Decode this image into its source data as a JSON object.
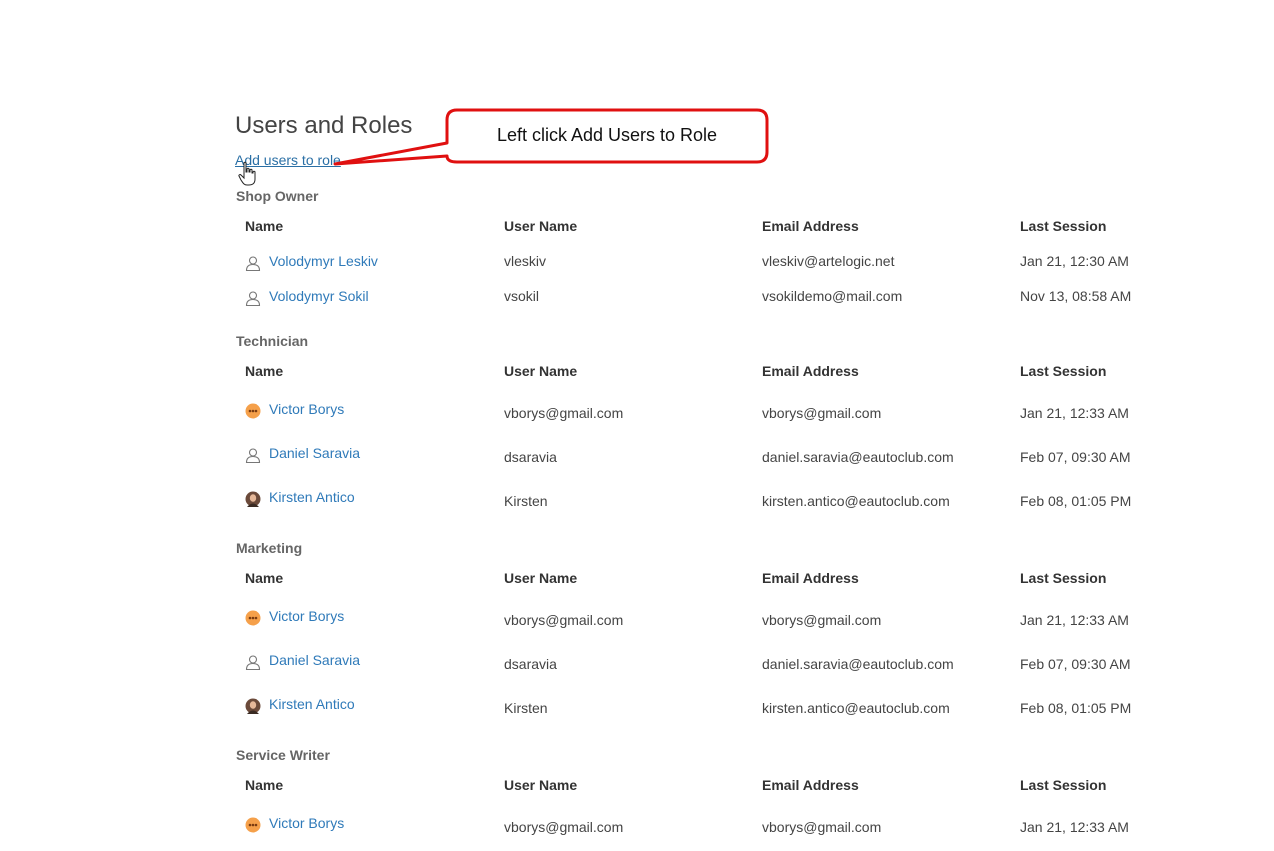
{
  "page": {
    "title": "Users and Roles",
    "add_link": "Add users to role"
  },
  "callout": {
    "text": "Left click Add Users to Role"
  },
  "columns": {
    "name": "Name",
    "user_name": "User Name",
    "email": "Email Address",
    "last_session": "Last Session"
  },
  "roles": [
    {
      "title": "Shop Owner",
      "users": [
        {
          "name": "Volodymyr Leskiv",
          "avatar": "person-outline-icon",
          "user_name": "vleskiv",
          "email": "vleskiv@artelogic.net",
          "last_session": "Jan 21, 12:30 AM"
        },
        {
          "name": "Volodymyr Sokil",
          "avatar": "person-outline-icon",
          "user_name": "vsokil",
          "email": "vsokildemo@mail.com",
          "last_session": "Nov 13, 08:58 AM"
        }
      ]
    },
    {
      "title": "Technician",
      "users": [
        {
          "name": "Victor Borys",
          "avatar": "orange-emoji-avatar",
          "user_name": "vborys@gmail.com",
          "email": "vborys@gmail.com",
          "last_session": "Jan 21, 12:33 AM"
        },
        {
          "name": "Daniel Saravia",
          "avatar": "person-outline-icon",
          "user_name": "dsaravia",
          "email": "daniel.saravia@eautoclub.com",
          "last_session": "Feb 07, 09:30 AM"
        },
        {
          "name": "Kirsten Antico",
          "avatar": "photo-avatar",
          "user_name": "Kirsten",
          "email": "kirsten.antico@eautoclub.com",
          "last_session": "Feb 08, 01:05 PM"
        }
      ]
    },
    {
      "title": "Marketing",
      "users": [
        {
          "name": "Victor Borys",
          "avatar": "orange-emoji-avatar",
          "user_name": "vborys@gmail.com",
          "email": "vborys@gmail.com",
          "last_session": "Jan 21, 12:33 AM"
        },
        {
          "name": "Daniel Saravia",
          "avatar": "person-outline-icon",
          "user_name": "dsaravia",
          "email": "daniel.saravia@eautoclub.com",
          "last_session": "Feb 07, 09:30 AM"
        },
        {
          "name": "Kirsten Antico",
          "avatar": "photo-avatar",
          "user_name": "Kirsten",
          "email": "kirsten.antico@eautoclub.com",
          "last_session": "Feb 08, 01:05 PM"
        }
      ]
    },
    {
      "title": "Service Writer",
      "users": [
        {
          "name": "Victor Borys",
          "avatar": "orange-emoji-avatar",
          "user_name": "vborys@gmail.com",
          "email": "vborys@gmail.com",
          "last_session": "Jan 21, 12:33 AM"
        }
      ]
    }
  ],
  "colors": {
    "link": "#2f7ab9",
    "callout_border": "#e01010",
    "header_text": "#333333",
    "role_title": "#666666"
  }
}
